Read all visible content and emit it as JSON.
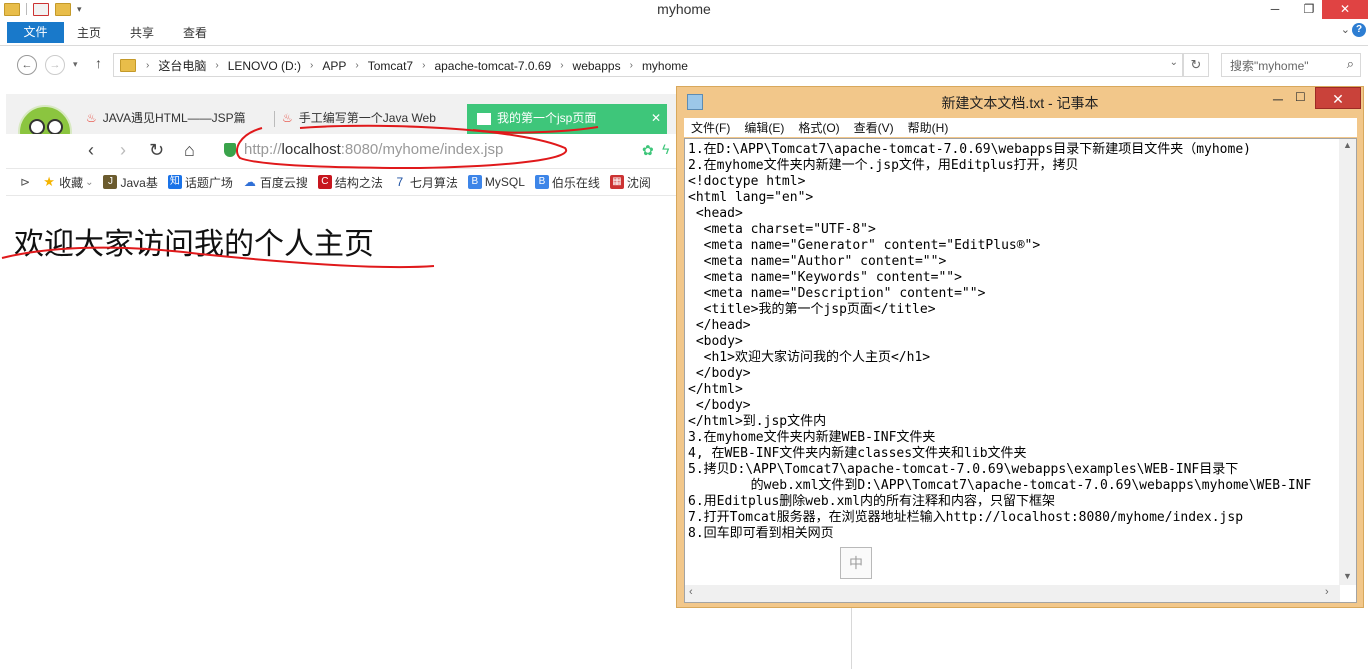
{
  "explorer": {
    "title": "myhome",
    "ribbon_tabs": {
      "file": "文件",
      "home": "主页",
      "share": "共享",
      "view": "查看"
    },
    "breadcrumb": [
      "这台电脑",
      "LENOVO (D:)",
      "APP",
      "Tomcat7",
      "apache-tomcat-7.0.69",
      "webapps",
      "myhome"
    ],
    "search_placeholder": "搜索\"myhome\""
  },
  "browser": {
    "tabs": [
      {
        "label": "JAVA遇见HTML——JSP篇",
        "active": false
      },
      {
        "label": "手工编写第一个Java Web",
        "active": false
      },
      {
        "label": "我的第一个jsp页面",
        "active": true
      }
    ],
    "url_prefix": "http://",
    "url_host": "localhost",
    "url_rest": ":8080/myhome/index.jsp",
    "bookmarks": [
      {
        "label": "收藏",
        "icon": "star-icon"
      },
      {
        "label": "Java基",
        "icon": "java-icon"
      },
      {
        "label": "话题广场",
        "icon": "zhihu-icon"
      },
      {
        "label": "百度云搜",
        "icon": "cloud-icon"
      },
      {
        "label": "结构之法",
        "icon": "csdn-icon"
      },
      {
        "label": "七月算法",
        "icon": "seven-icon"
      },
      {
        "label": "MySQL",
        "icon": "blog-icon"
      },
      {
        "label": "伯乐在线",
        "icon": "blog-icon"
      },
      {
        "label": "沈阅",
        "icon": "app-icon"
      }
    ],
    "page_heading": "欢迎大家访问我的个人主页"
  },
  "notepad": {
    "title": "新建文本文档.txt - 记事本",
    "menu": [
      "文件(F)",
      "编辑(E)",
      "格式(O)",
      "查看(V)",
      "帮助(H)"
    ],
    "lines": [
      "1.在D:\\APP\\Tomcat7\\apache-tomcat-7.0.69\\webapps目录下新建项目文件夹（myhome)",
      "2.在myhome文件夹内新建一个.jsp文件，用Editplus打开，拷贝",
      "<!doctype html>",
      "<html lang=\"en\">",
      " <head>",
      "  <meta charset=\"UTF-8\">",
      "  <meta name=\"Generator\" content=\"EditPlus®\">",
      "  <meta name=\"Author\" content=\"\">",
      "  <meta name=\"Keywords\" content=\"\">",
      "  <meta name=\"Description\" content=\"\">",
      "  <title>我的第一个jsp页面</title>",
      " </head>",
      " <body>",
      "  <h1>欢迎大家访问我的个人主页</h1>",
      " </body>",
      "</html>",
      " </body>",
      "</html>到.jsp文件内",
      "3.在myhome文件夹内新建WEB-INF文件夹",
      "4, 在WEB-INF文件夹内新建classes文件夹和lib文件夹",
      "5.拷贝D:\\APP\\Tomcat7\\apache-tomcat-7.0.69\\webapps\\examples\\WEB-INF目录下",
      "        的web.xml文件到D:\\APP\\Tomcat7\\apache-tomcat-7.0.69\\webapps\\myhome\\WEB-INF",
      "6.用Editplus删除web.xml内的所有注释和内容，只留下框架",
      "7.打开Tomcat服务器，在浏览器地址栏输入http://localhost:8080/myhome/index.jsp",
      "8.回车即可看到相关网页"
    ],
    "ime_label": "中"
  }
}
